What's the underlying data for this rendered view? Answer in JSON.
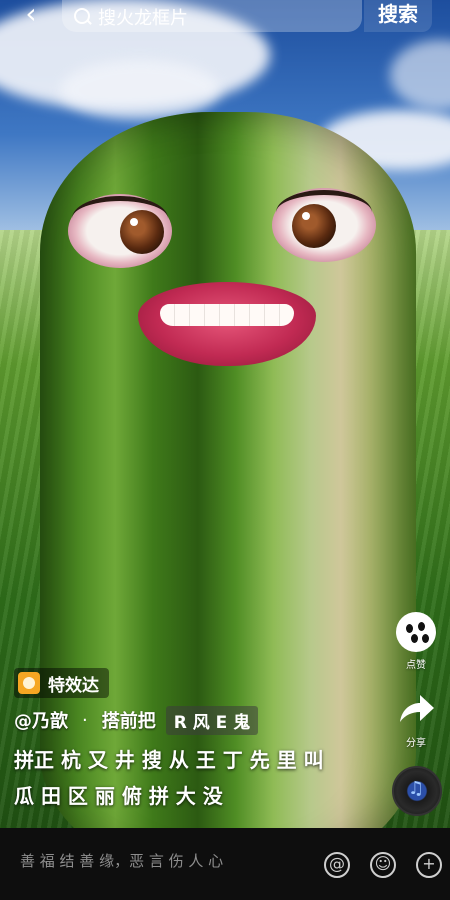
{
  "topbar": {
    "back_icon": "chevron-left-icon",
    "search_placeholder": "搜火龙框片",
    "search_button": "搜索"
  },
  "rail": {
    "like_label": "点赞",
    "share_label": "分享",
    "music_icon": "music-disc-icon"
  },
  "video_info": {
    "tag_label": "特效达",
    "author": "@乃歆",
    "author_separator": "·",
    "author_time": "搭前把",
    "author_chip": "R 风 E 鬼",
    "caption_line1": "拼正 杭 又 井 搜 从 王 丁 先  里 叫",
    "caption_line2": "瓜 田 区 丽 俯 拼 大 没"
  },
  "bottom_bar": {
    "comment_placeholder": "善 福 结 善 缘，恶 言 伤 人 心",
    "mention_icon": "at-icon",
    "emoji_icon": "emoji-icon",
    "add_icon": "plus-icon"
  },
  "colors": {
    "tag_accent": "#f5a623",
    "bottom_bar": "#0e0e0e"
  }
}
